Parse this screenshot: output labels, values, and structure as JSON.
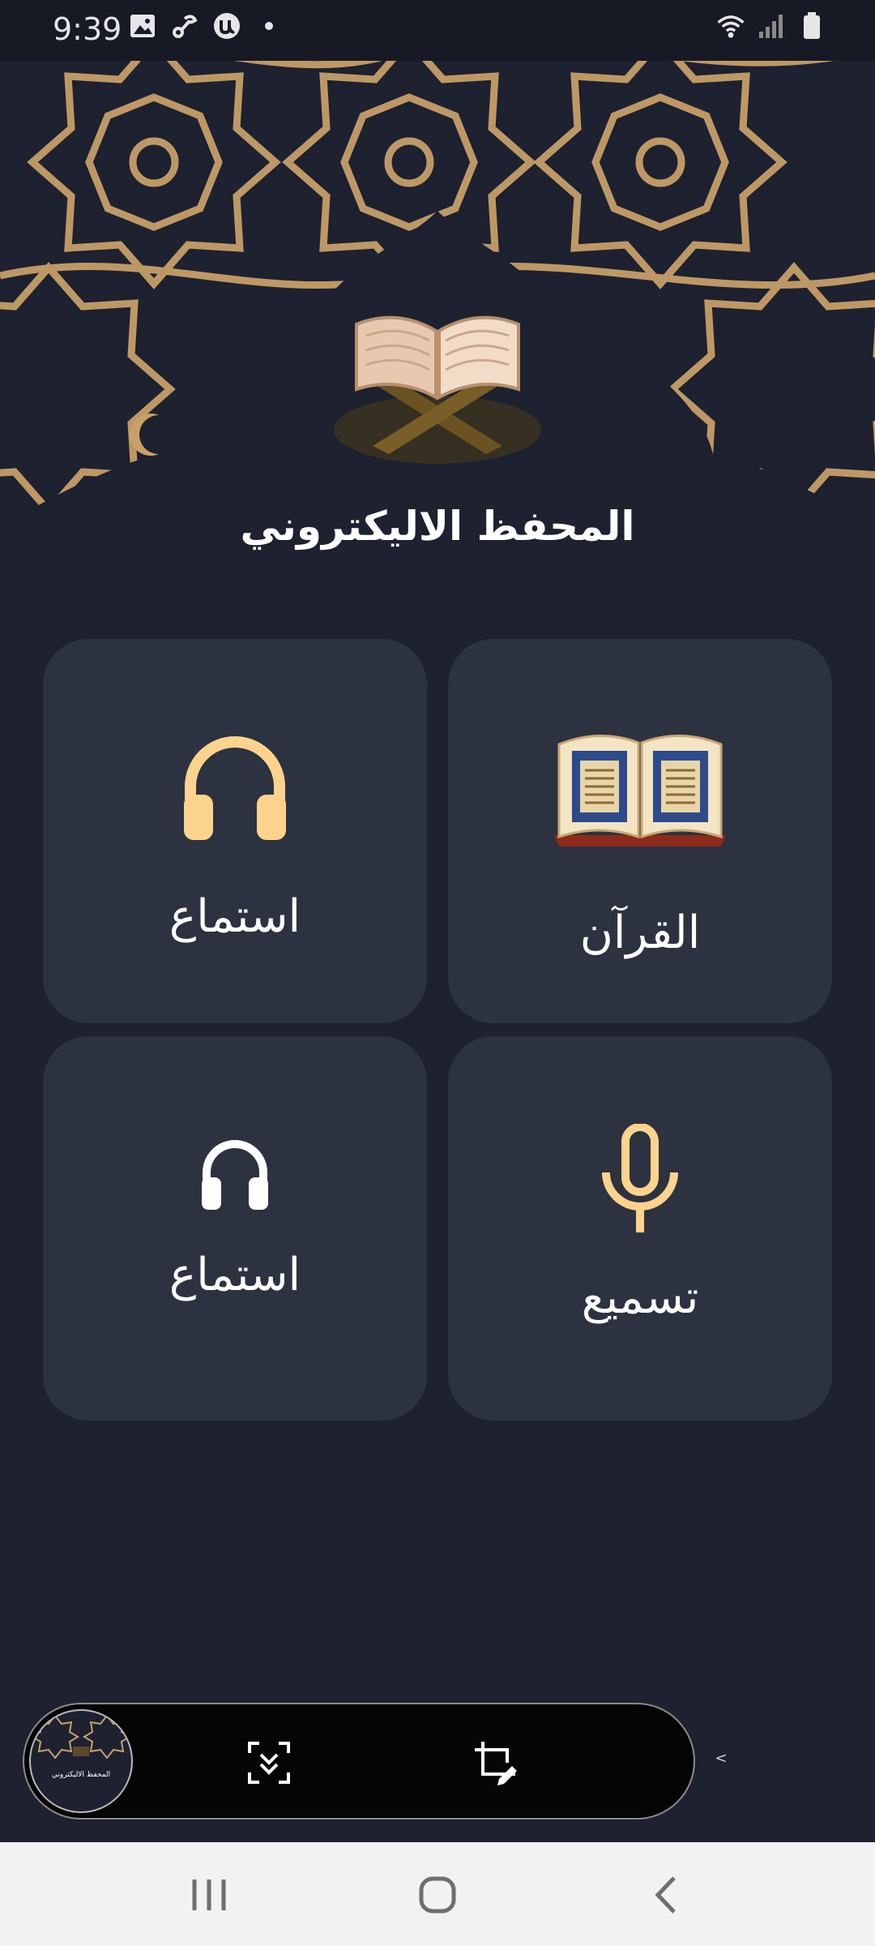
{
  "status_bar": {
    "time": "9:39",
    "left_icons": [
      "gallery-icon",
      "link-icon",
      "u-app-icon",
      "dot-icon"
    ],
    "right_icons": [
      "wifi-icon",
      "signal-icon",
      "battery-icon"
    ]
  },
  "header": {
    "title": "المحفظ الاليكتروني"
  },
  "cards": [
    {
      "label": "القرآن",
      "icon": "quran-book-icon"
    },
    {
      "label": "استماع",
      "icon": "headphones-icon",
      "icon_color": "#fbd38d"
    },
    {
      "label": "تسميع",
      "icon": "microphone-icon",
      "icon_color": "#fbd38d"
    },
    {
      "label": "استماع",
      "icon": "headphones-icon",
      "icon_color": "#ffffff"
    }
  ],
  "floating_toolbar": {
    "thumbnail_title": "المحفظ الاليكتروني",
    "buttons": [
      "scroll-capture-icon",
      "crop-edit-icon"
    ],
    "collapse_glyph": "<"
  },
  "colors": {
    "background": "#1d2130",
    "card": "#2d3241",
    "accent": "#fbd38d",
    "pattern_gold": "#c8a068"
  }
}
